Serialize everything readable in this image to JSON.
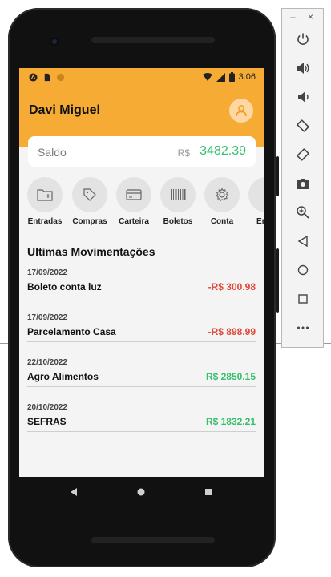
{
  "status_bar": {
    "time": "3:06"
  },
  "header": {
    "user_name": "Davi Miguel"
  },
  "balance": {
    "label": "Saldo",
    "currency": "R$",
    "value": "3482.39"
  },
  "shortcuts": [
    {
      "label": "Entradas",
      "icon": "folder-plus-icon"
    },
    {
      "label": "Compras",
      "icon": "tag-icon"
    },
    {
      "label": "Carteira",
      "icon": "card-icon"
    },
    {
      "label": "Boletos",
      "icon": "barcode-icon"
    },
    {
      "label": "Conta",
      "icon": "gear-icon"
    },
    {
      "label": "Em c",
      "icon": "more-icon"
    }
  ],
  "movements": {
    "title": "Ultimas Movimentações",
    "items": [
      {
        "date": "17/09/2022",
        "description": "Boleto conta luz",
        "amount": "-R$ 300.98",
        "type": "out"
      },
      {
        "date": "17/09/2022",
        "description": "Parcelamento Casa",
        "amount": "-R$ 898.99",
        "type": "out"
      },
      {
        "date": "22/10/2022",
        "description": "Agro Alimentos",
        "amount": "R$ 2850.15",
        "type": "in"
      },
      {
        "date": "20/10/2022",
        "description": "SEFRAS",
        "amount": "R$ 1832.21",
        "type": "in"
      }
    ]
  },
  "colors": {
    "accent": "#f6ab35",
    "positive": "#34c06b",
    "negative": "#e04a3c"
  },
  "emulator_panel": {
    "minimize": "–",
    "close": "×",
    "buttons": [
      "power-icon",
      "volume-up-icon",
      "volume-down-icon",
      "rotate-left-icon",
      "rotate-right-icon",
      "camera-icon",
      "zoom-icon",
      "back-icon",
      "home-icon",
      "overview-icon",
      "more-icon"
    ]
  }
}
